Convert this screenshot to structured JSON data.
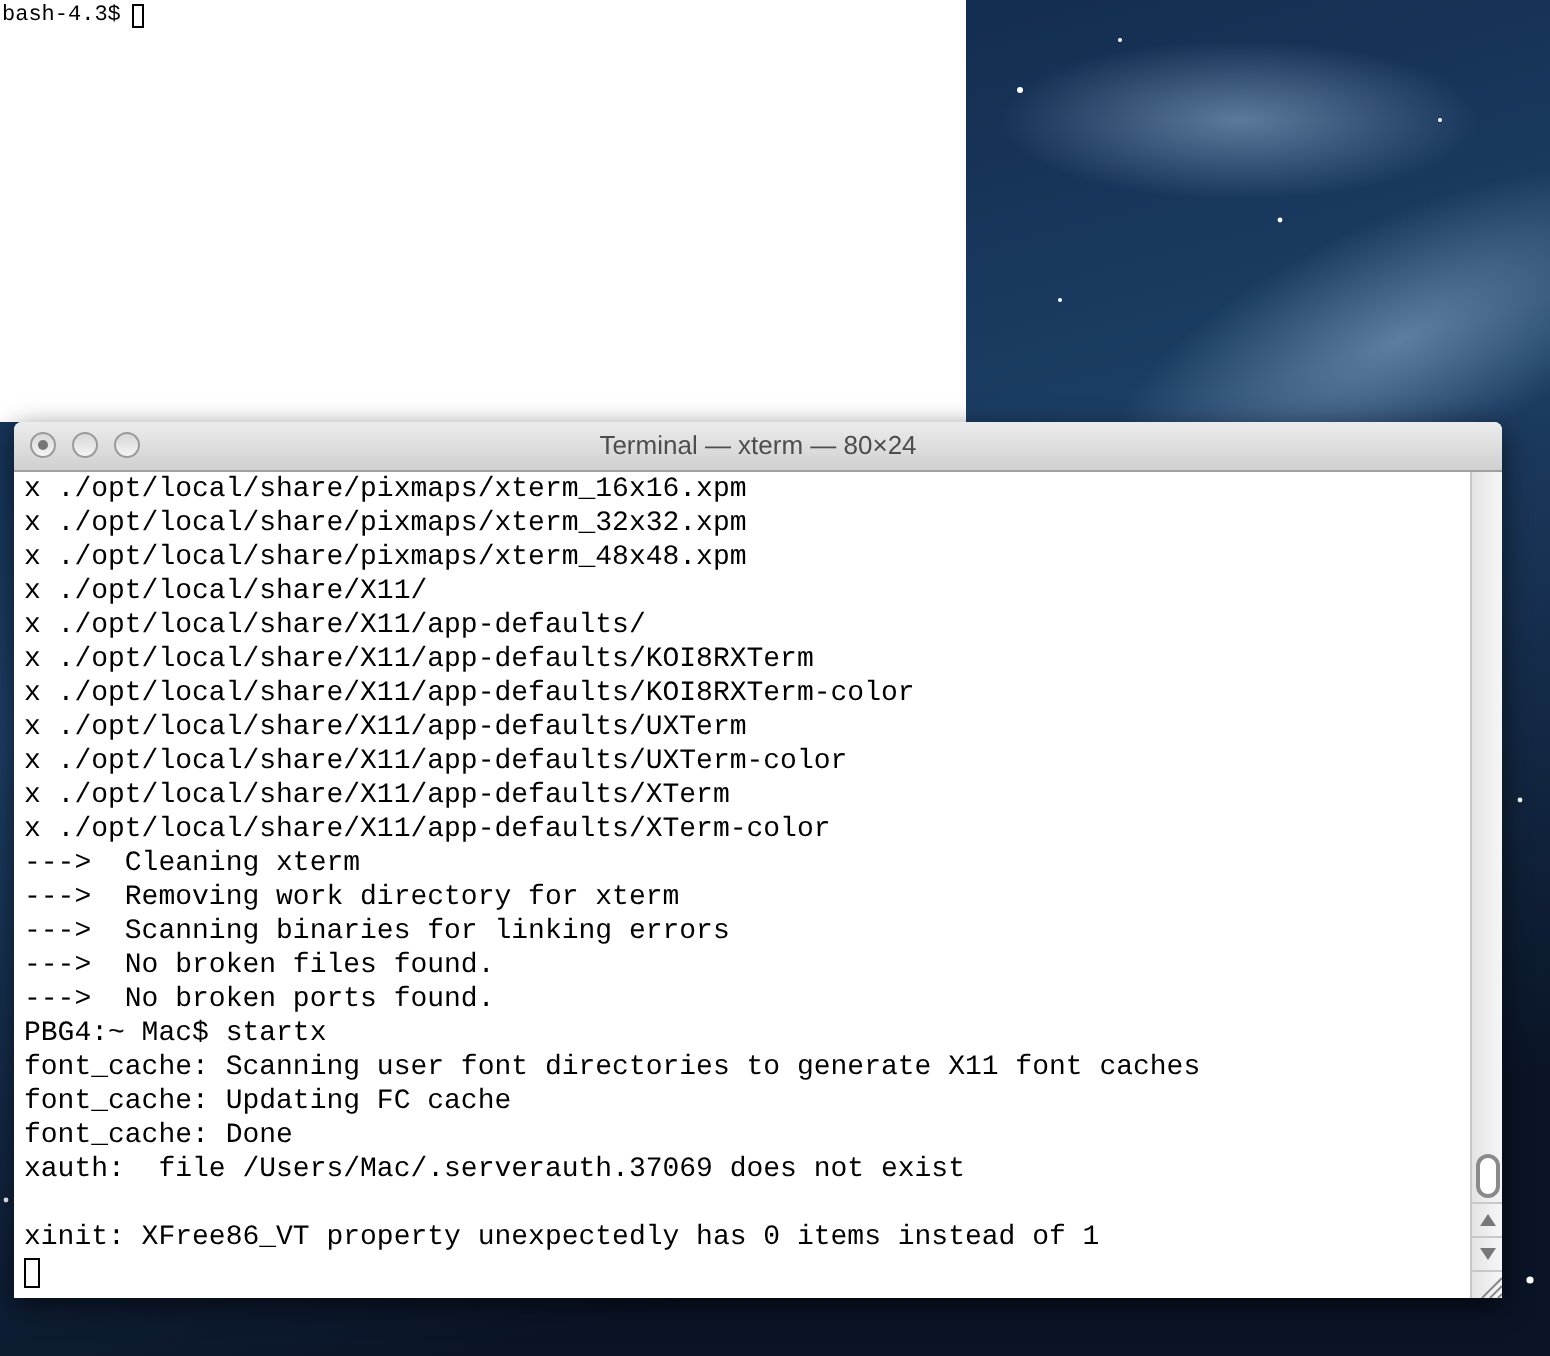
{
  "background_terminal": {
    "prompt": "bash-4.3$"
  },
  "terminal": {
    "title": "Terminal — xterm — 80×24",
    "lines": [
      {
        "kind": "text",
        "text": "x ./opt/local/share/pixmaps/xterm_16x16.xpm"
      },
      {
        "kind": "text",
        "text": "x ./opt/local/share/pixmaps/xterm_32x32.xpm"
      },
      {
        "kind": "text",
        "text": "x ./opt/local/share/pixmaps/xterm_48x48.xpm"
      },
      {
        "kind": "text",
        "text": "x ./opt/local/share/X11/"
      },
      {
        "kind": "text",
        "text": "x ./opt/local/share/X11/app-defaults/"
      },
      {
        "kind": "text",
        "text": "x ./opt/local/share/X11/app-defaults/KOI8RXTerm"
      },
      {
        "kind": "text",
        "text": "x ./opt/local/share/X11/app-defaults/KOI8RXTerm-color"
      },
      {
        "kind": "text",
        "text": "x ./opt/local/share/X11/app-defaults/UXTerm"
      },
      {
        "kind": "text",
        "text": "x ./opt/local/share/X11/app-defaults/UXTerm-color"
      },
      {
        "kind": "text",
        "text": "x ./opt/local/share/X11/app-defaults/XTerm"
      },
      {
        "kind": "text",
        "text": "x ./opt/local/share/X11/app-defaults/XTerm-color"
      },
      {
        "kind": "text",
        "text": "--->  Cleaning xterm"
      },
      {
        "kind": "text",
        "text": "--->  Removing work directory for xterm"
      },
      {
        "kind": "text",
        "text": "--->  Scanning binaries for linking errors"
      },
      {
        "kind": "text",
        "text": "--->  No broken files found."
      },
      {
        "kind": "text",
        "text": "--->  No broken ports found."
      },
      {
        "kind": "text",
        "text": "PBG4:~ Mac$ startx"
      },
      {
        "kind": "text",
        "text": "font_cache: Scanning user font directories to generate X11 font caches"
      },
      {
        "kind": "text",
        "text": "font_cache: Updating FC cache"
      },
      {
        "kind": "text",
        "text": "font_cache: Done"
      },
      {
        "kind": "text",
        "text": "xauth:  file /Users/Mac/.serverauth.37069 does not exist"
      },
      {
        "kind": "blank"
      },
      {
        "kind": "text",
        "text": "xinit: XFree86_VT property unexpectedly has 0 items instead of 1"
      },
      {
        "kind": "cursor"
      }
    ]
  }
}
